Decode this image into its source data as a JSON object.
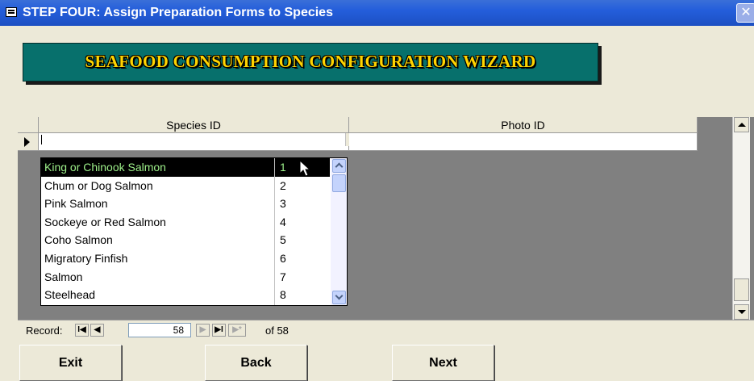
{
  "window": {
    "title": "STEP FOUR:  Assign Preparation Forms to Species",
    "close_glyph": "✕",
    "title_color": "#245edb"
  },
  "banner": {
    "text": "SEAFOOD CONSUMPTION CONFIGURATION WIZARD",
    "background": "#07706c",
    "text_color": "#ffd400"
  },
  "datasheet": {
    "columns": [
      "Species ID",
      "Photo ID"
    ],
    "current_row": {
      "species_id": "",
      "photo_id": ""
    }
  },
  "dropdown": {
    "selected_index": 0,
    "items": [
      {
        "name": "King or Chinook Salmon",
        "id": "1"
      },
      {
        "name": "Chum or Dog Salmon",
        "id": "2"
      },
      {
        "name": "Pink Salmon",
        "id": "3"
      },
      {
        "name": "Sockeye or Red Salmon",
        "id": "4"
      },
      {
        "name": "Coho Salmon",
        "id": "5"
      },
      {
        "name": "Migratory Finfish",
        "id": "6"
      },
      {
        "name": "Salmon",
        "id": "7"
      },
      {
        "name": "Steelhead",
        "id": "8"
      }
    ]
  },
  "navigation": {
    "label": "Record:",
    "current": "58",
    "total_text": "of 58",
    "first_glyph": "I◀",
    "prev_glyph": "◀",
    "next_glyph": "▶",
    "last_glyph": "▶I",
    "new_glyph": "▶*"
  },
  "buttons": {
    "exit": "Exit",
    "back": "Back",
    "next": "Next"
  }
}
